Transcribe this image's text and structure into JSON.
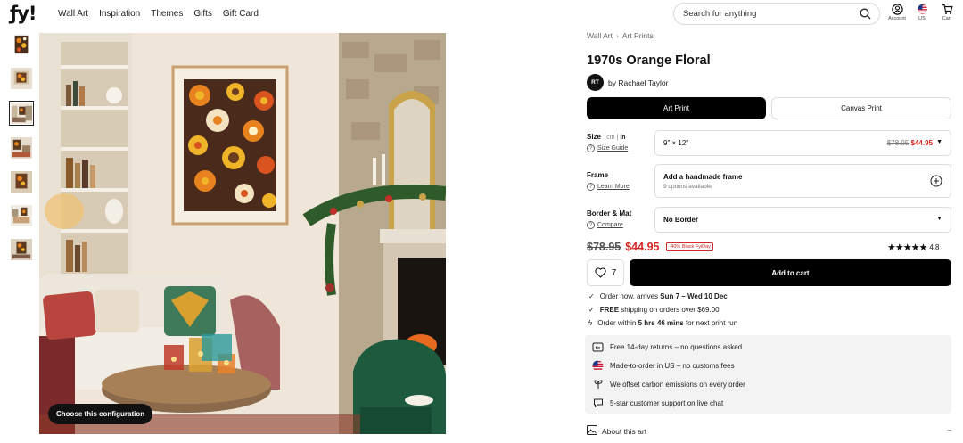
{
  "header": {
    "logo": "ƒy!",
    "nav": [
      "Wall Art",
      "Inspiration",
      "Themes",
      "Gifts",
      "Gift Card"
    ],
    "search_placeholder": "Search for anything",
    "icons": [
      {
        "label": "Account",
        "icon": "account-icon"
      },
      {
        "label": "US",
        "icon": "us-flag-icon"
      },
      {
        "label": "Cart",
        "icon": "cart-icon"
      }
    ]
  },
  "gallery": {
    "config_button": "Choose this configuration",
    "selected_thumb": 2
  },
  "product": {
    "breadcrumb": [
      "Wall Art",
      "Art Prints"
    ],
    "title": "1970s Orange Floral",
    "artist_initials": "RT",
    "artist": "by Rachael Taylor",
    "tabs": {
      "art_print": "Art Print",
      "canvas_print": "Canvas Print"
    },
    "size": {
      "label": "Size",
      "unit_cm": "cm",
      "unit_sep": "|",
      "unit_in": "in",
      "link": "Size Guide",
      "value": "9\" × 12\"",
      "old_price": "$78.95",
      "new_price": "$44.95"
    },
    "frame": {
      "label": "Frame",
      "link": "Learn More",
      "value": "Add a handmade frame",
      "sub": "9 options available"
    },
    "border": {
      "label": "Border & Mat",
      "link": "Compare",
      "value": "No Border"
    },
    "price": {
      "old": "$78.95",
      "new": "$44.95",
      "badge": "-40% Black FyiDay"
    },
    "rating": {
      "stars": "★★★★★",
      "value": "4.8"
    },
    "wishlist_count": "7",
    "add_to_cart": "Add to cart",
    "shipping": [
      {
        "pre": "Order now, arrives ",
        "bold": "Sun 7 – Wed 10 Dec",
        "post": ""
      },
      {
        "pre": "",
        "bold": "FREE",
        "post": " shipping on orders over $69.00"
      },
      {
        "pre": "Order within ",
        "bold": "5 hrs 46 mins",
        "post": " for next print run"
      }
    ],
    "perks": [
      {
        "icon": "returns-icon",
        "text": "Free 14-day returns – no questions asked"
      },
      {
        "icon": "us-flag-icon",
        "text": "Made-to-order in US – no customs fees"
      },
      {
        "icon": "sprout-icon",
        "text": "We offset carbon emissions on every order"
      },
      {
        "icon": "chat-icon",
        "text": "5-star customer support on live chat"
      }
    ],
    "about": "About this art",
    "about_toggle": "–"
  }
}
